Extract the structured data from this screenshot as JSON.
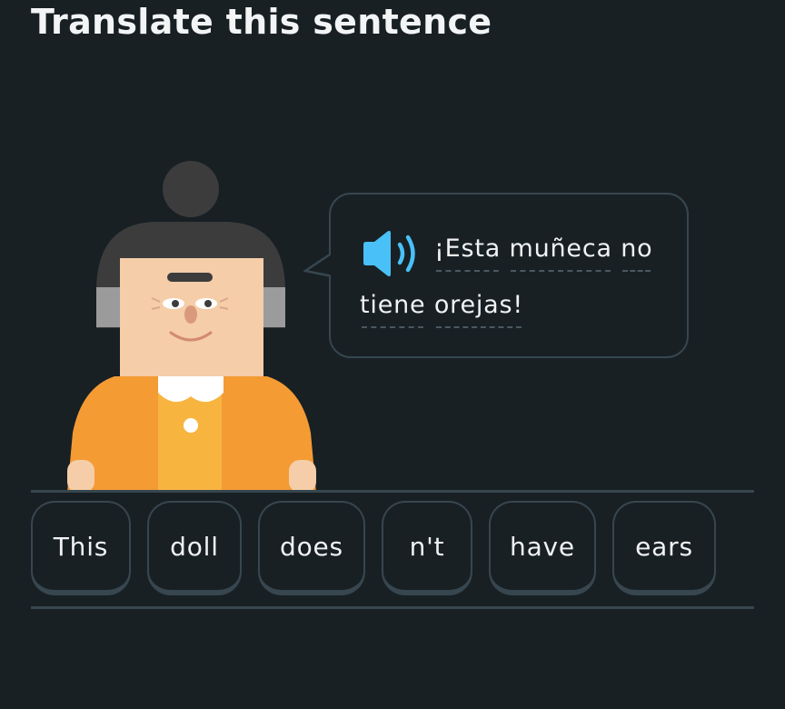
{
  "header": {
    "title": "Translate this sentence"
  },
  "prompt": {
    "audio_icon": "speaker-icon",
    "line1_words": [
      "¡Esta",
      "muñeca",
      "no"
    ],
    "line2_words": [
      "tiene",
      "orejas!"
    ]
  },
  "word_bank": {
    "tiles": [
      "This",
      "doll",
      "does",
      "n't",
      "have",
      "ears"
    ]
  },
  "colors": {
    "background": "#182024",
    "border": "#37464f",
    "speaker_blue": "#49c0f8",
    "shirt_orange": "#f49b34",
    "text": "#f0f2f3"
  }
}
